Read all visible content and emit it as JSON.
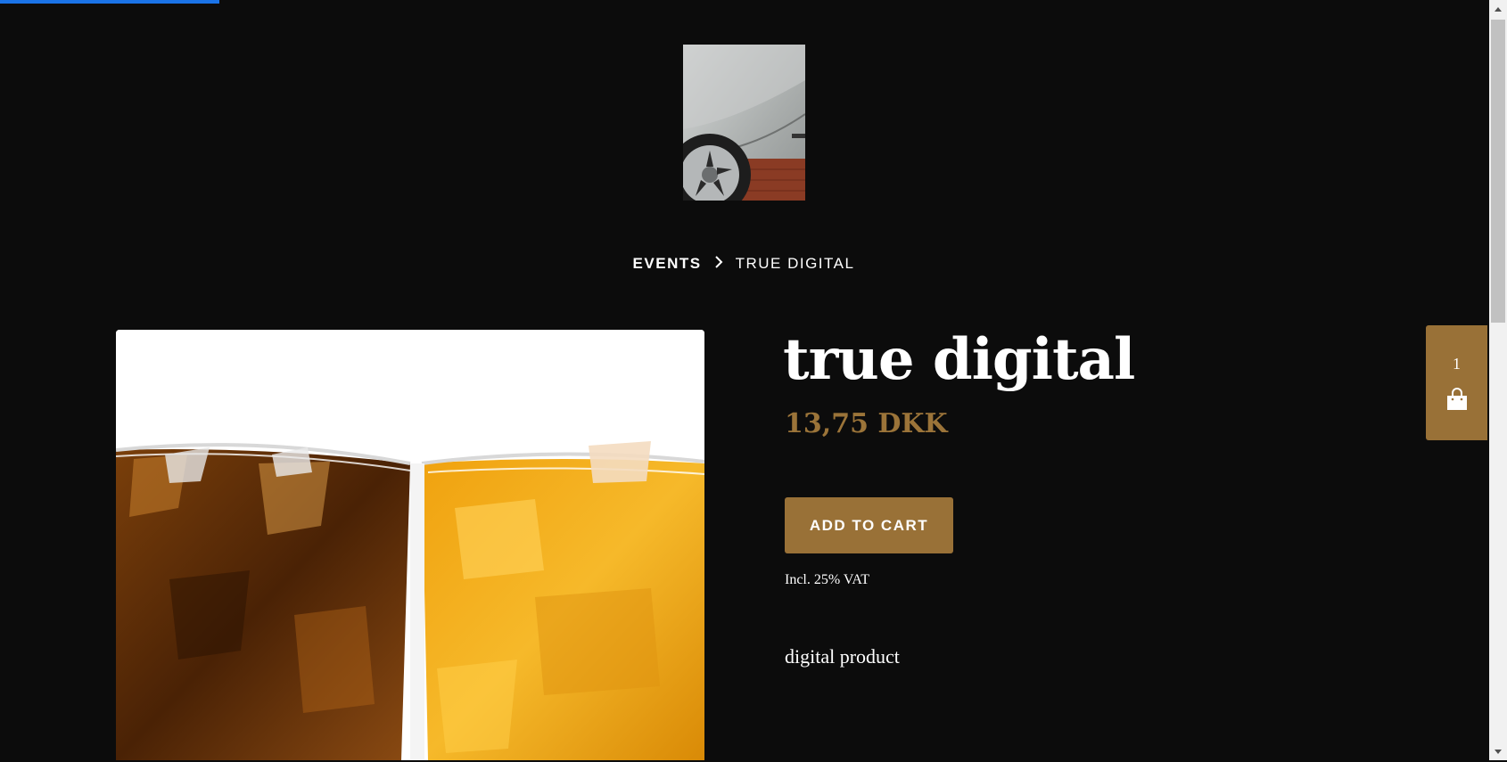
{
  "page": {
    "progress_color": "#1a73e8",
    "background": "#0c0c0c",
    "accent": "#997137"
  },
  "header": {
    "logo_alt": "car wheel photo"
  },
  "breadcrumb": {
    "parent": "EVENTS",
    "separator_icon": "chevron-right-icon",
    "current": "TRUE DIGITAL"
  },
  "product": {
    "title": "true digital",
    "price": "13,75 DKK",
    "add_to_cart_label": "ADD TO CART",
    "vat_note": "Incl. 25% VAT",
    "description": "digital product",
    "image_alt": "two glasses of iced drinks"
  },
  "cart": {
    "count": "1",
    "icon": "shopping-bag-icon"
  }
}
